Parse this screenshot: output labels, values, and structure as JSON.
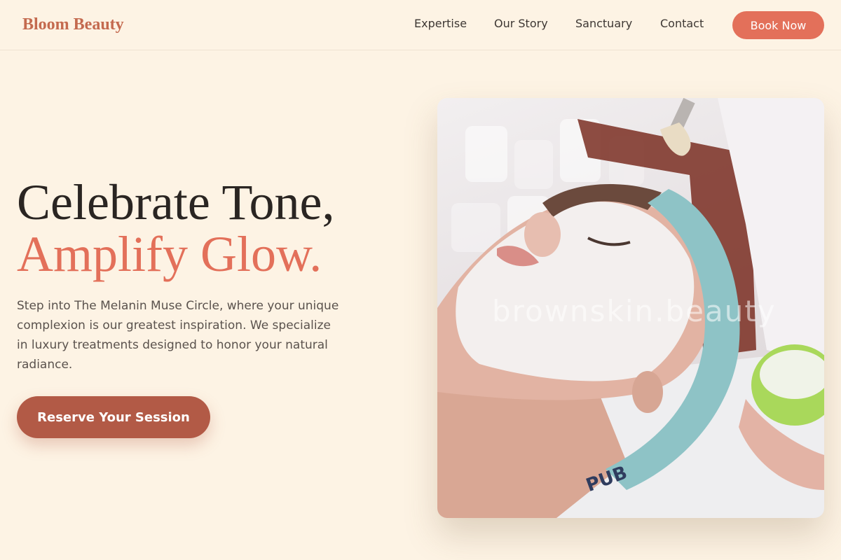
{
  "brand": {
    "name": "Bloom Beauty",
    "accent": "#e3705a",
    "accent_dark": "#b25a46",
    "background": "#fdf3e4"
  },
  "nav": {
    "items": [
      {
        "label": "Expertise"
      },
      {
        "label": "Our Story"
      },
      {
        "label": "Sanctuary"
      },
      {
        "label": "Contact"
      }
    ],
    "cta_label": "Book Now"
  },
  "hero": {
    "title_line1": "Celebrate Tone,",
    "title_line2": "Amplify Glow.",
    "description": "Step into The Melanin Muse Circle, where your unique complexion is our greatest inspiration. We specialize in luxury treatments designed to honor your natural radiance.",
    "cta_label": "Reserve Your Session",
    "image": {
      "watermark": "brownskin.beauty",
      "headband_text": "PUB"
    }
  }
}
